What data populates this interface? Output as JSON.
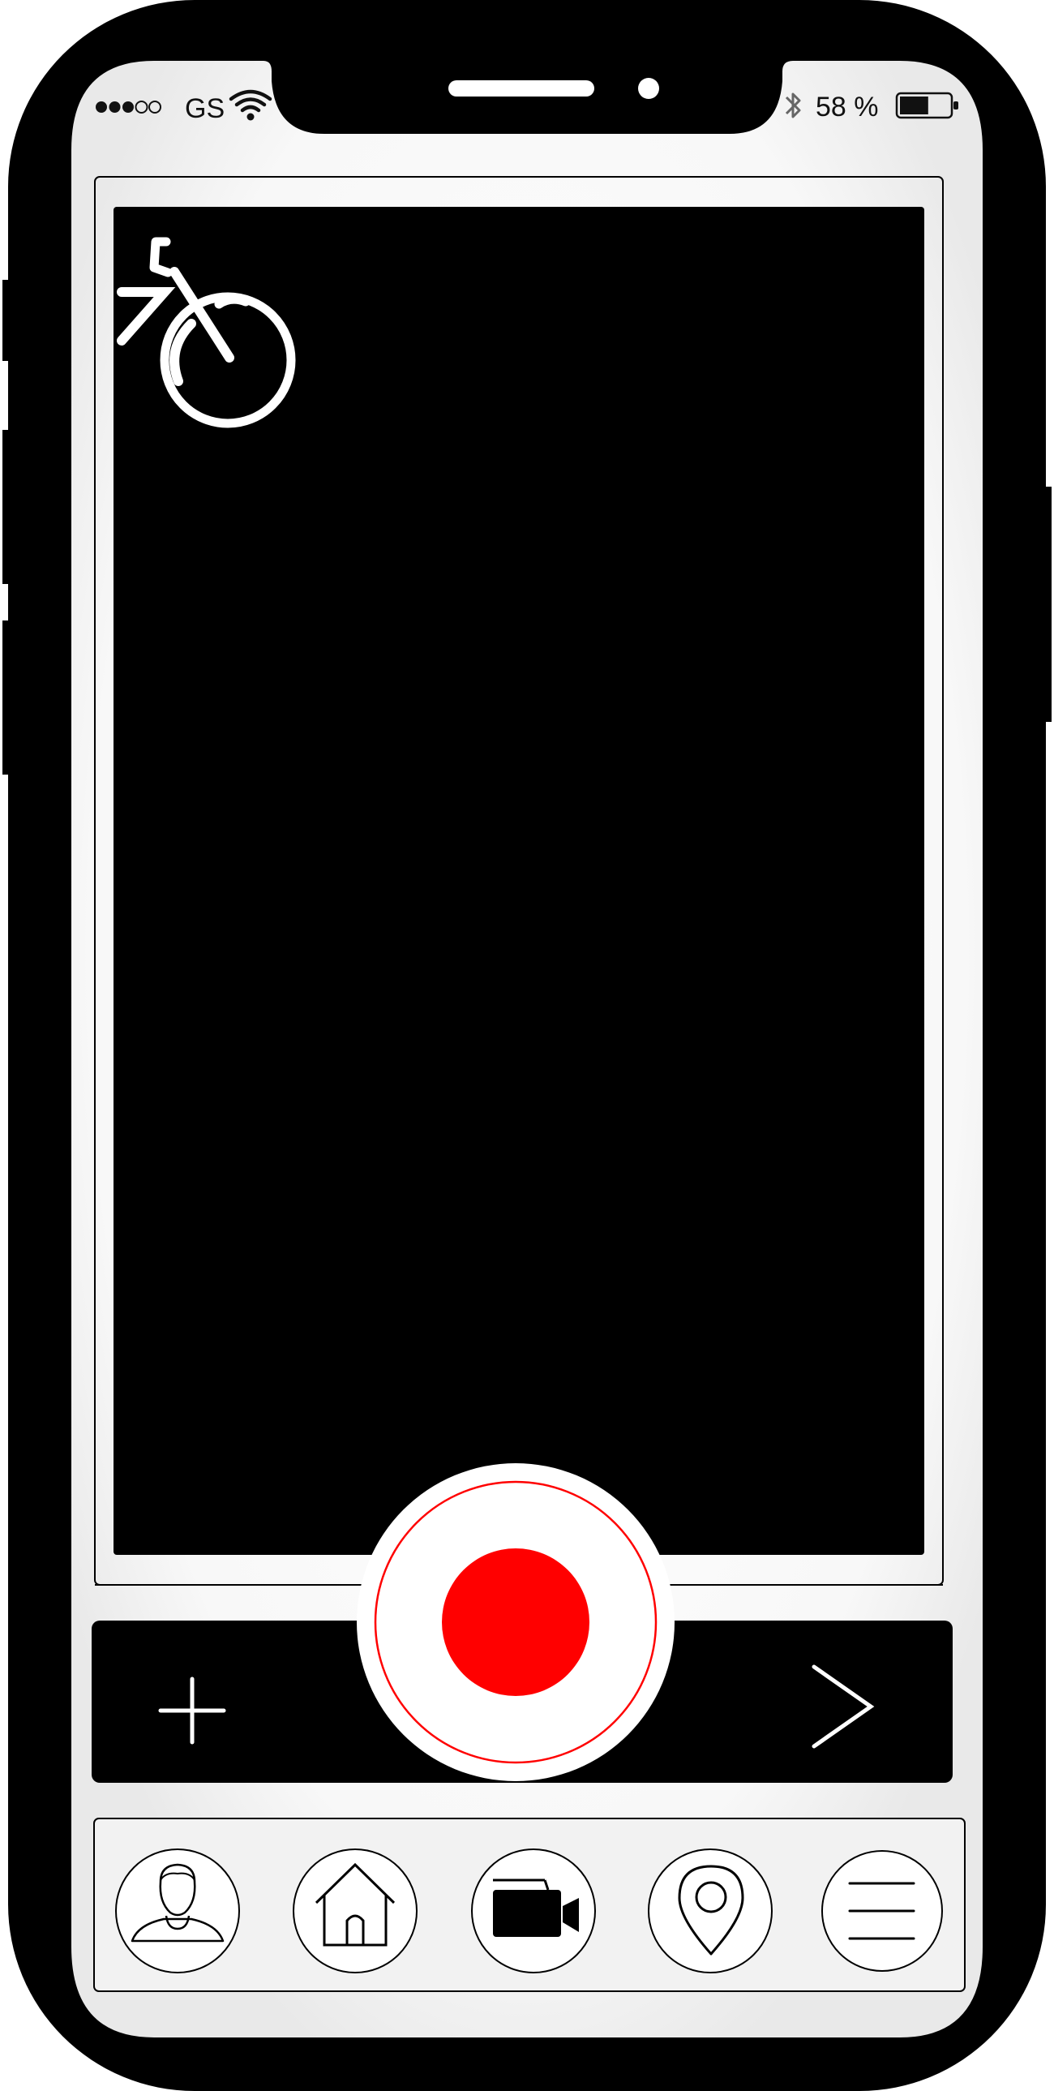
{
  "status_bar": {
    "carrier": "GS",
    "signal_bars_filled": 3,
    "signal_bars_total": 5,
    "battery_text": "58 %",
    "battery_level": 0.58,
    "icons": [
      "wifi-icon",
      "bluetooth-icon",
      "battery-icon"
    ]
  },
  "viewfinder": {
    "mode_icon": "bicycle-icon"
  },
  "controls": {
    "add_icon": "plus-icon",
    "record_icon": "record-icon",
    "next_icon": "chevron-right-icon",
    "record_color": "#ff0000"
  },
  "tab_bar": {
    "items": [
      {
        "icon": "user-icon"
      },
      {
        "icon": "home-icon"
      },
      {
        "icon": "video-camera-icon"
      },
      {
        "icon": "location-pin-icon"
      },
      {
        "icon": "menu-icon"
      }
    ]
  },
  "colors": {
    "frame": "#000000",
    "screen": "#ffffff",
    "accent": "#ff0000"
  }
}
